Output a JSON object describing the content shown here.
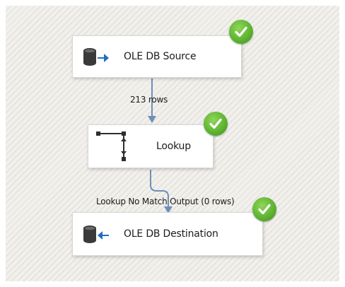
{
  "canvas": {
    "background": "#f1f0ec",
    "stripe_color": "#dedbd2"
  },
  "components": {
    "source": {
      "label": "OLE DB Source",
      "icon": "database-output-icon",
      "status": "success",
      "status_icon": "green-check-icon"
    },
    "lookup": {
      "label": "Lookup",
      "icon": "lookup-icon",
      "status": "success",
      "status_icon": "green-check-icon"
    },
    "destination": {
      "label": "OLE DB Destination",
      "icon": "database-input-icon",
      "status": "success",
      "status_icon": "green-check-icon"
    }
  },
  "paths": {
    "source_to_lookup": {
      "label": "213 rows"
    },
    "lookup_to_destination": {
      "label": "Lookup No Match Output (0 rows)"
    }
  },
  "colors": {
    "path_line": "#6f8fb9",
    "check_green": "#5fb531",
    "db_icon": "#3a3a3a",
    "arrow_blue": "#1f6fc4"
  }
}
